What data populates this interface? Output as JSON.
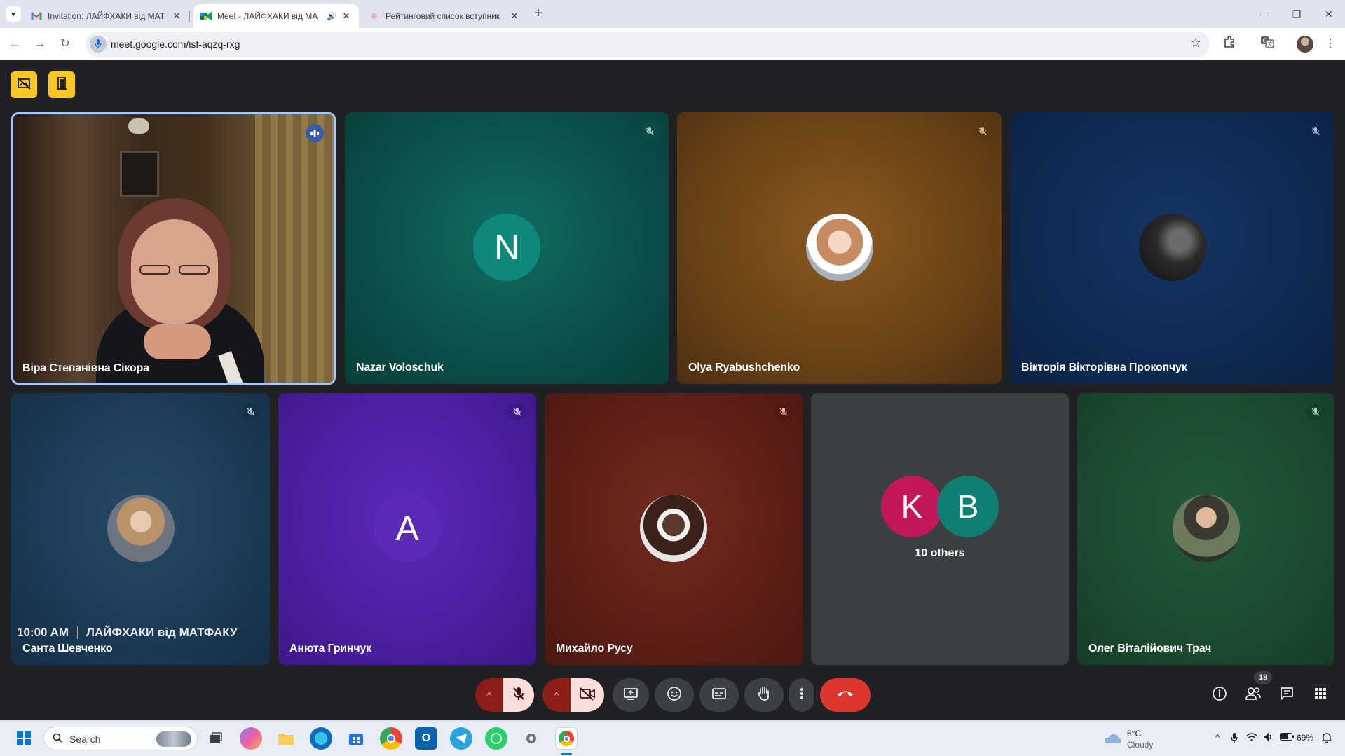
{
  "browser": {
    "tabs": [
      {
        "title": "Invitation: ЛАЙФХАКИ від МАТ",
        "favicon": "gmail-icon",
        "active": false
      },
      {
        "title": "Meet - ЛАЙФХАКИ від МА",
        "favicon": "meet-icon",
        "active": true,
        "audible": true
      },
      {
        "title": "Рейтинговий список вступник",
        "favicon": "loading-dot-icon",
        "active": false
      }
    ],
    "url": "meet.google.com/isf-aqzq-rxg"
  },
  "meeting": {
    "time": "10:00 AM",
    "title": "ЛАЙФХАКИ від МАТФАКУ",
    "participant_count": "18"
  },
  "tiles": [
    {
      "name": "Віра Степанівна Сікора",
      "type": "video",
      "speaking": true
    },
    {
      "name": "Nazar Voloschuk",
      "type": "letter",
      "letter": "N",
      "bg": "#0e4f48",
      "avatar_color": "#0f766e",
      "muted": true
    },
    {
      "name": "Olya Ryabushchenko",
      "type": "photo",
      "bg": "#6a4216",
      "muted": true
    },
    {
      "name": "Вікторія Вікторівна Прокопчук",
      "type": "photo",
      "bg": "#0f2a52",
      "muted": true
    },
    {
      "name": "Санта Шевченко",
      "type": "photo",
      "bg": "#1c3a55",
      "muted": true
    },
    {
      "name": "Анюта Гринчук",
      "type": "letter",
      "letter": "A",
      "bg": "#4a1fa0",
      "avatar_color": "#5b2bb5",
      "muted": true
    },
    {
      "name": "Михайло Русу",
      "type": "photo",
      "bg": "#5c1f17",
      "muted": true
    },
    {
      "name": "10 others",
      "type": "others",
      "letters": [
        "K",
        "B"
      ],
      "colors": [
        "#c2185b",
        "#0f766e"
      ]
    },
    {
      "name": "Олег Віталійович Трач",
      "type": "photo",
      "bg": "#1c4a30",
      "muted": true
    }
  ],
  "taskbar": {
    "search_label": "Search",
    "weather_temp": "6°C",
    "weather_desc": "Cloudy",
    "battery": "69%"
  }
}
